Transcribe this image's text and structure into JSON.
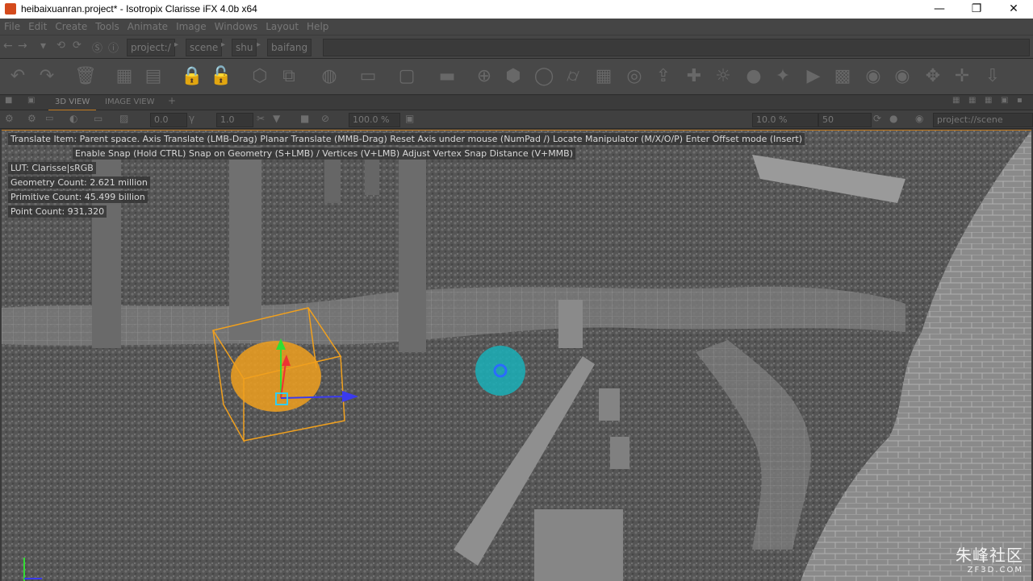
{
  "window": {
    "title": "heibaixuanran.project* - Isotropix Clarisse iFX 4.0b x64",
    "controls": [
      "—",
      "❐",
      "✕"
    ]
  },
  "menu": [
    "File",
    "Edit",
    "Create",
    "Tools",
    "Animate",
    "Image",
    "Windows",
    "Layout",
    "Help"
  ],
  "breadcrumbs": [
    "project:/",
    "scene",
    "shu",
    "baifang"
  ],
  "tabs": [
    "3D VIEW",
    "IMAGE VIEW"
  ],
  "view_options": {
    "field1": "0.0",
    "field2": "1.0",
    "zoom": "100.0 %",
    "pct": "10.0 %",
    "samples": "50",
    "context": "project://scene"
  },
  "viewport": {
    "help_line1": "Translate Item: Parent space. Axis Translate (LMB-Drag)  Planar Translate (MMB-Drag) Reset Axis under mouse (NumPad /)  Locate Manipulator (M/X/O/P)  Enter Offset mode (Insert)",
    "help_line2": "Enable Snap (Hold CTRL) Snap on Geometry (S+LMB) / Vertices (V+LMB) Adjust Vertex Snap Distance (V+MMB)",
    "lut": "LUT: Clarisse|sRGB",
    "geometry_count": "Geometry Count: 2.621 million",
    "primitive_count": "Primitive Count: 45.499 billion",
    "point_count": "Point Count: 931,320"
  },
  "watermark": {
    "main": "朱峰社区",
    "sub": "ZF3D.COM"
  },
  "colors": {
    "accent": "#c27a1e",
    "selection": "#f0a01e",
    "manipulator": "#1ab0b8"
  }
}
